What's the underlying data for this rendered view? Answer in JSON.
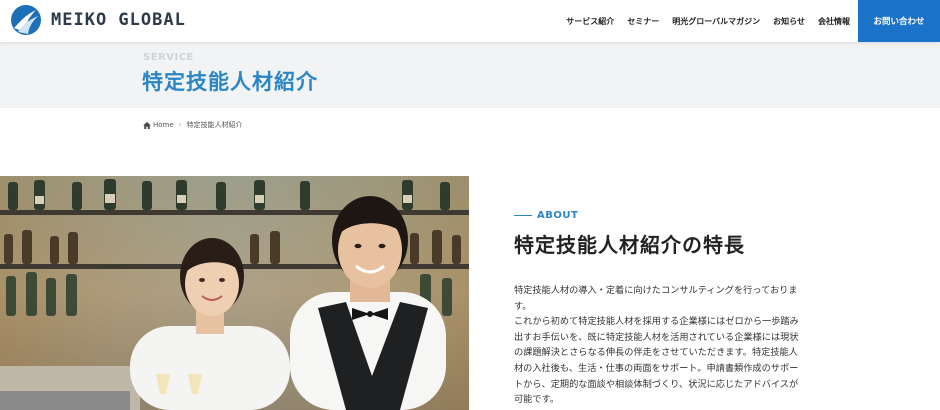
{
  "header": {
    "logo_text": "MEIKO GLOBAL",
    "nav": [
      "サービス紹介",
      "セミナー",
      "明光グローバルマガジン",
      "お知らせ",
      "会社情報"
    ],
    "contact_label": "お問い合わせ"
  },
  "page": {
    "eyebrow": "SERVICE",
    "title": "特定技能人材紹介"
  },
  "breadcrumb": {
    "home": "Home",
    "current": "特定技能人材紹介"
  },
  "about": {
    "label": "ABOUT",
    "title": "特定技能人材紹介の特長",
    "paragraph1": "特定技能人材の導入・定着に向けたコンサルティングを行っております。",
    "paragraph2": "これから初めて特定技能人材を採用する企業様にはゼロから一歩踏み出すお手伝いを、既に特定技能人材を活用されている企業様には現状の課題解決とさらなる伸長の伴走をさせていただきます。特定技能人材の入社後も、生活・仕事の両面をサポート。申請書類作成のサポートから、定期的な面談や相談体制づくり、状況に応じたアドバイスが可能です。"
  },
  "colors": {
    "accent": "#2a86c4",
    "contact_button": "#1a73c8",
    "title_band": "#f2f3f4"
  }
}
